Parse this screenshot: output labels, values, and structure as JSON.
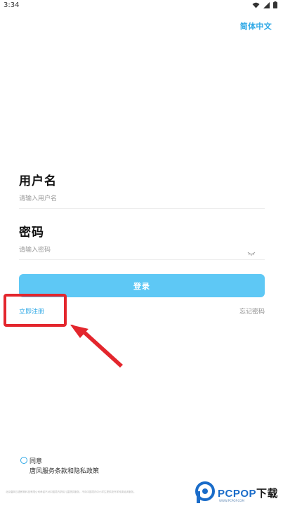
{
  "status_bar": {
    "time": "3:34",
    "icons": [
      "wifi-icon",
      "signal-icon",
      "battery-icon"
    ]
  },
  "header": {
    "language": "简体中文"
  },
  "login_form": {
    "username_label": "用户名",
    "username_placeholder": "请输入用户名",
    "password_label": "密码",
    "password_placeholder": "请输入密码",
    "login_button": "登录",
    "register_link": "立即注册",
    "forgot_password_link": "忘记密码"
  },
  "agreement": {
    "agree_label": "同意",
    "terms_link": "唐风服务条款和隐私政策"
  },
  "footer": {
    "note": "北京唐风汉语教育科技有限公司承诺不对中国境内学前儿童提供服务，不向中国境内中小学生提供校外学科类培训服务。"
  },
  "watermark": {
    "brand": "PCPOP",
    "suffix": "下载",
    "subtitle": "WWW.PCPOP.COM"
  },
  "colors": {
    "accent": "#2ea8e6",
    "button": "#5ec8f5",
    "annotation": "#e3262d"
  }
}
